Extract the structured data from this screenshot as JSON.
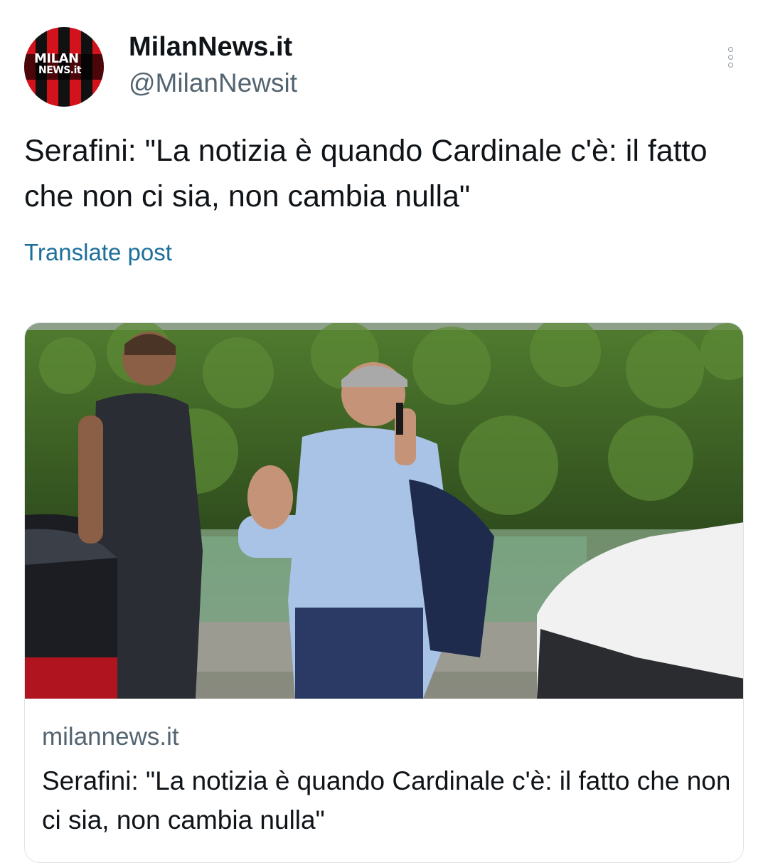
{
  "account": {
    "name": "MilanNews.it",
    "handle": "@MilanNewsit",
    "avatar_line1": "MILAN",
    "avatar_line2": "NEWS.it",
    "avatar_colors": [
      "#d3121c",
      "#111111"
    ]
  },
  "tweet": {
    "text": "Serafini: \"La notizia è quando Cardinale c'è: il fatto che non ci sia, non cambia nulla\"",
    "translate_label": "Translate post"
  },
  "card": {
    "image_icon": "photo-icon",
    "domain": "milannews.it",
    "title": "Serafini: \"La notizia è quando Cardinale c'è: il fatto che non ci sia, non cambia nulla\""
  },
  "colors": {
    "text": "#0f1419",
    "secondary": "#536471",
    "link": "#1d6f9b"
  }
}
